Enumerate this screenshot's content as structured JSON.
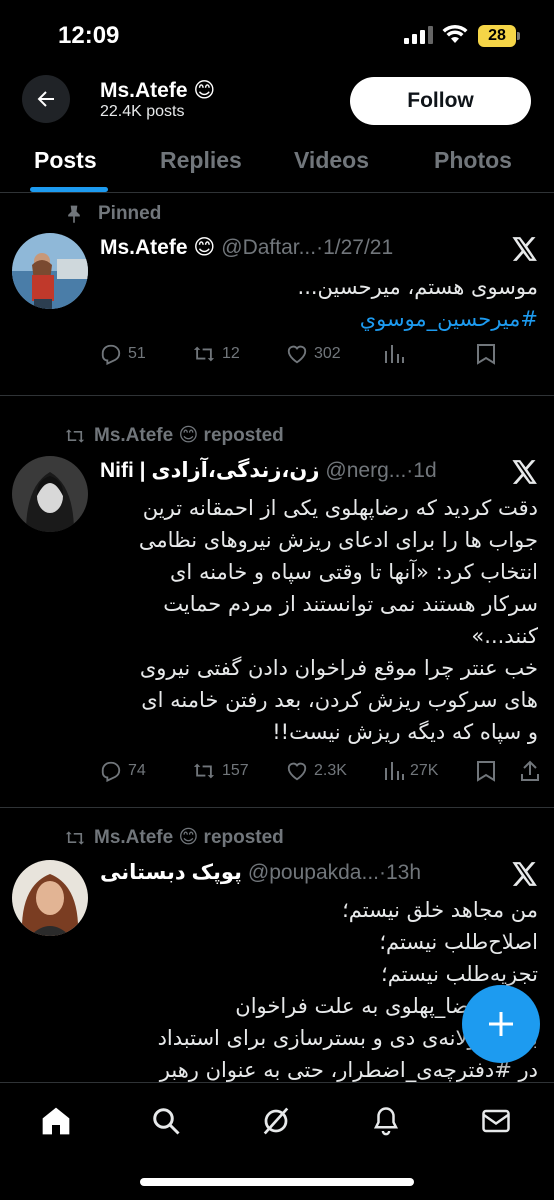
{
  "status_bar": {
    "time": "12:09",
    "battery": "28"
  },
  "header": {
    "name": "Ms.Atefe 😊",
    "posts_count": "22.4K posts",
    "follow_label": "Follow"
  },
  "tabs": [
    {
      "label": "Posts",
      "active": true
    },
    {
      "label": "Replies",
      "active": false
    },
    {
      "label": "Videos",
      "active": false
    },
    {
      "label": "Photos",
      "active": false
    }
  ],
  "tweets": [
    {
      "context": "Pinned",
      "display_name": "Ms.Atefe 😊",
      "handle": "@Daftar...",
      "time": "·1/27/21",
      "text_lines": [
        "موسوی هستم، میرحسین..."
      ],
      "hashtag": "#میرحسین_موسوي",
      "replies": "51",
      "reposts": "12",
      "likes": "302"
    },
    {
      "context": "Ms.Atefe 😊 reposted",
      "display_name": "Nifi | زن،زندگی،آزادی",
      "handle": "@nerg...",
      "time": "·1d",
      "text_lines": [
        "دقت کردید که رضاپهلوی یکی از احمقانه ترین",
        "جواب ها را برای ادعای ریزش نیروهای نظامی",
        "انتخاب کرد: «آنها تا وقتی سپاه و خامنه ای",
        "سرکار هستند نمی توانستند از مردم حمایت",
        "کنند...»",
        "خب عنتر چرا موقع فراخوان دادن گفتی نیروی",
        "های سرکوب ریزش کردن، بعد رفتن خامنه ای",
        "و سپاه که دیگه ریزش نیست!!"
      ],
      "replies": "74",
      "reposts": "157",
      "likes": "2.3K",
      "views": "27K"
    },
    {
      "context": "Ms.Atefe 😊 reposted",
      "display_name": "پوپک دبستانی",
      "handle": "@poupakda...",
      "time": "·13h",
      "text_lines": [
        "من مجاهد خلق نیستم؛",
        "اصلاح‌طلب نیستم؛",
        "تجزیه‌طلب نیستم؛",
        "ولی #رضا_پهلوی به علت فراخوان",
        "بی‌مسئولانه‌ی دی و بسترسازی برای استبداد",
        "در #دفترچه‌ی_اضطرار، حتی به عنوان رهبر"
      ]
    }
  ],
  "colors": {
    "accent": "#1d9bf0",
    "muted": "#71767b",
    "divider": "#2f3336"
  },
  "nav": [
    "home-icon",
    "search-icon",
    "grok-icon",
    "notifications-icon",
    "messages-icon"
  ]
}
